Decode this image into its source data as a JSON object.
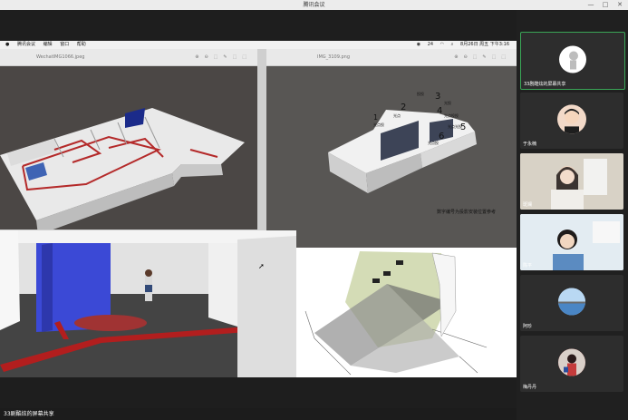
{
  "window": {
    "title": "腾讯会议"
  },
  "mac_menubar": {
    "items": [
      "腾讯会议",
      "编辑",
      "窗口",
      "帮助"
    ],
    "tray_count": "24",
    "clock": "8月26日 周五 下午3:16"
  },
  "viewers": [
    {
      "filename": "WechatIMG1066.jpeg"
    },
    {
      "filename": "IMG_3109.png"
    }
  ],
  "projection_plan": {
    "caption": "数字编号为投影安装位置参考",
    "room_labels": [
      "光点投",
      "光点",
      "投投",
      "光投",
      "光点投投",
      "光点光投",
      "光点投"
    ],
    "room_numbers": [
      "1",
      "2",
      "3",
      "4",
      "5",
      "6"
    ]
  },
  "share_bar": {
    "label": "33剧酷炫的屏幕共享"
  },
  "participants": [
    {
      "name": "33剧酷炫的屏幕共享",
      "avatar_color": "#ffffff"
    },
    {
      "name": "于永楠",
      "avatar_color": "#f2d9c8"
    },
    {
      "name": "斑斓",
      "avatar_color": "#f3e7d8"
    },
    {
      "name": "陈平",
      "avatar_color": "#dbe7ef"
    },
    {
      "name": "阿珍",
      "avatar_color": "#9ec7ea"
    },
    {
      "name": "梅丹丹",
      "avatar_color": "#c43b3b"
    }
  ],
  "colors": {
    "accent": "#3aa657",
    "stage_bg": "#1e1e1e"
  }
}
